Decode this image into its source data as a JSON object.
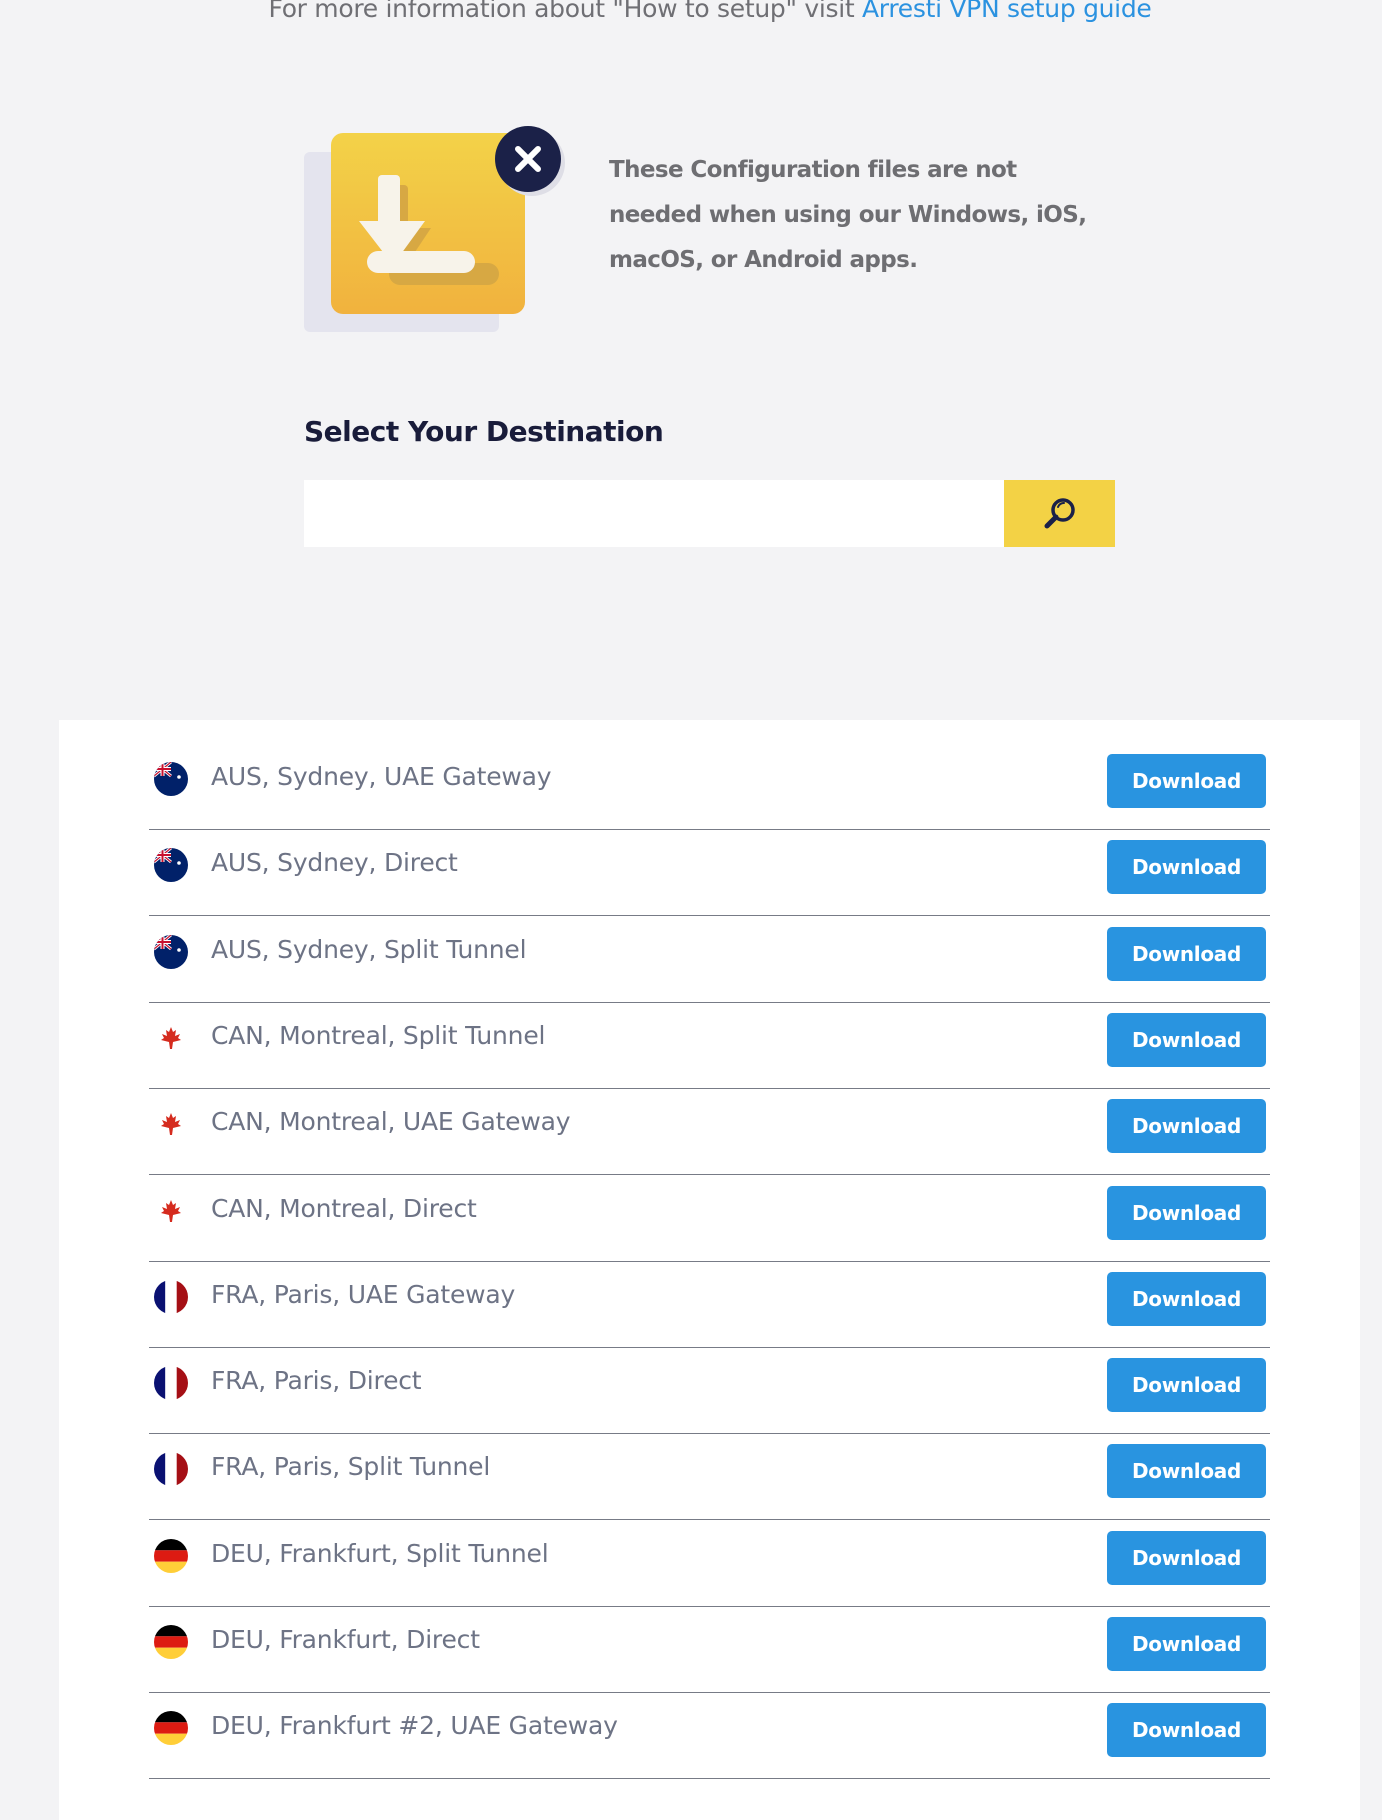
{
  "info": {
    "prefix": "For more information about \"How to setup\" visit ",
    "link_text": "Arresti VPN setup guide"
  },
  "notice": {
    "icon": "download-config-icon",
    "badge_icon": "close-icon",
    "text": "These Configuration files are not needed when using our Windows, iOS, macOS, or Android apps."
  },
  "destination": {
    "title": "Select Your Destination",
    "search_value": "",
    "search_placeholder": "",
    "search_icon": "search-icon"
  },
  "colors": {
    "accent_yellow": "#f3d245",
    "download_blue": "#2994e0",
    "link_blue": "#2b92e0",
    "navy": "#1b2148"
  },
  "servers": [
    {
      "flag": "aus",
      "label": "AUS, Sydney, UAE Gateway",
      "button": "Download"
    },
    {
      "flag": "aus",
      "label": "AUS, Sydney, Direct",
      "button": "Download"
    },
    {
      "flag": "aus",
      "label": "AUS, Sydney, Split Tunnel",
      "button": "Download"
    },
    {
      "flag": "can",
      "label": "CAN, Montreal, Split Tunnel",
      "button": "Download"
    },
    {
      "flag": "can",
      "label": "CAN, Montreal, UAE Gateway",
      "button": "Download"
    },
    {
      "flag": "can",
      "label": "CAN, Montreal, Direct",
      "button": "Download"
    },
    {
      "flag": "fra",
      "label": "FRA, Paris, UAE Gateway",
      "button": "Download"
    },
    {
      "flag": "fra",
      "label": "FRA, Paris, Direct",
      "button": "Download"
    },
    {
      "flag": "fra",
      "label": "FRA, Paris, Split Tunnel",
      "button": "Download"
    },
    {
      "flag": "deu",
      "label": "DEU, Frankfurt, Split Tunnel",
      "button": "Download"
    },
    {
      "flag": "deu",
      "label": "DEU, Frankfurt, Direct",
      "button": "Download"
    },
    {
      "flag": "deu",
      "label": "DEU, Frankfurt #2, UAE Gateway",
      "button": "Download"
    }
  ]
}
